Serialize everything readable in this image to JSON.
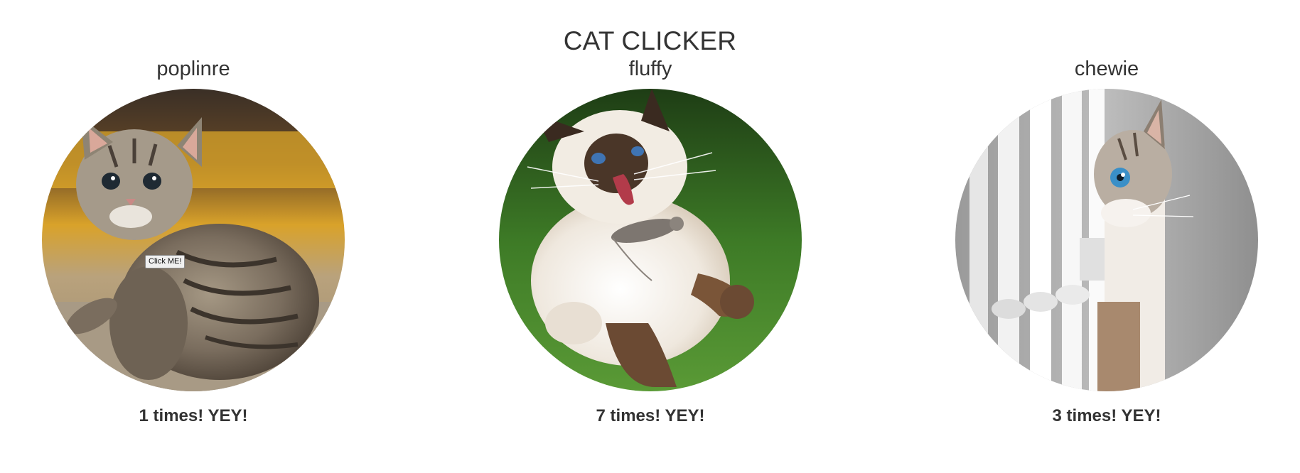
{
  "page": {
    "title": "CAT CLICKER"
  },
  "cats": [
    {
      "name": "poplinre",
      "count_text": "1 times! YEY!",
      "clicks": 1,
      "image": "tabby-kitten",
      "button_label": "Click ME!"
    },
    {
      "name": "fluffy",
      "count_text": "7 times! YEY!",
      "clicks": 7,
      "image": "siamese-cat-with-mouse"
    },
    {
      "name": "chewie",
      "count_text": "3 times! YEY!",
      "clicks": 3,
      "image": "cat-peeking-behind-railing"
    }
  ],
  "colors": {
    "text": "#333333",
    "background": "#ffffff"
  }
}
